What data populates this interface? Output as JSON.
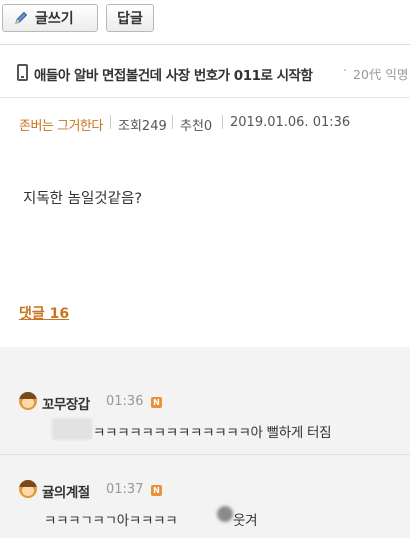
{
  "toolbar": {
    "write_label": "글쓰기",
    "reply_label": "답글"
  },
  "post": {
    "title": "애들아 알바 면접볼건데 사장 번호가 011로 시작함",
    "title_separator": "·",
    "board": "20代 익명",
    "author": "존버는 그거한다",
    "views": "조회249",
    "recommends": "추천0",
    "date": "2019.01.06. 01:36",
    "body": "지독한 놈일것같음?"
  },
  "comments_link": "댓글 16",
  "comments": [
    {
      "name": "꼬무장갑",
      "time": "01:36",
      "badge": "N",
      "text": "ㅋㅋㅋㅋㅋㅋㅋㅋㅋㅋㅋㅋㅋ아 뻘하게 터짐"
    },
    {
      "name": "귤의계절",
      "time": "01:37",
      "badge": "N",
      "text": "ㅋㅋㅋㄱㅋㄱ아ㅋㅋㅋㅋ",
      "text_after": "웃겨"
    }
  ],
  "colors": {
    "accent": "#c9741f",
    "badge": "#e8913a",
    "comment_bg": "#f3f3f3"
  },
  "icons": [
    "pencil-icon",
    "phone-icon",
    "avatar-icon",
    "new-badge-icon"
  ]
}
